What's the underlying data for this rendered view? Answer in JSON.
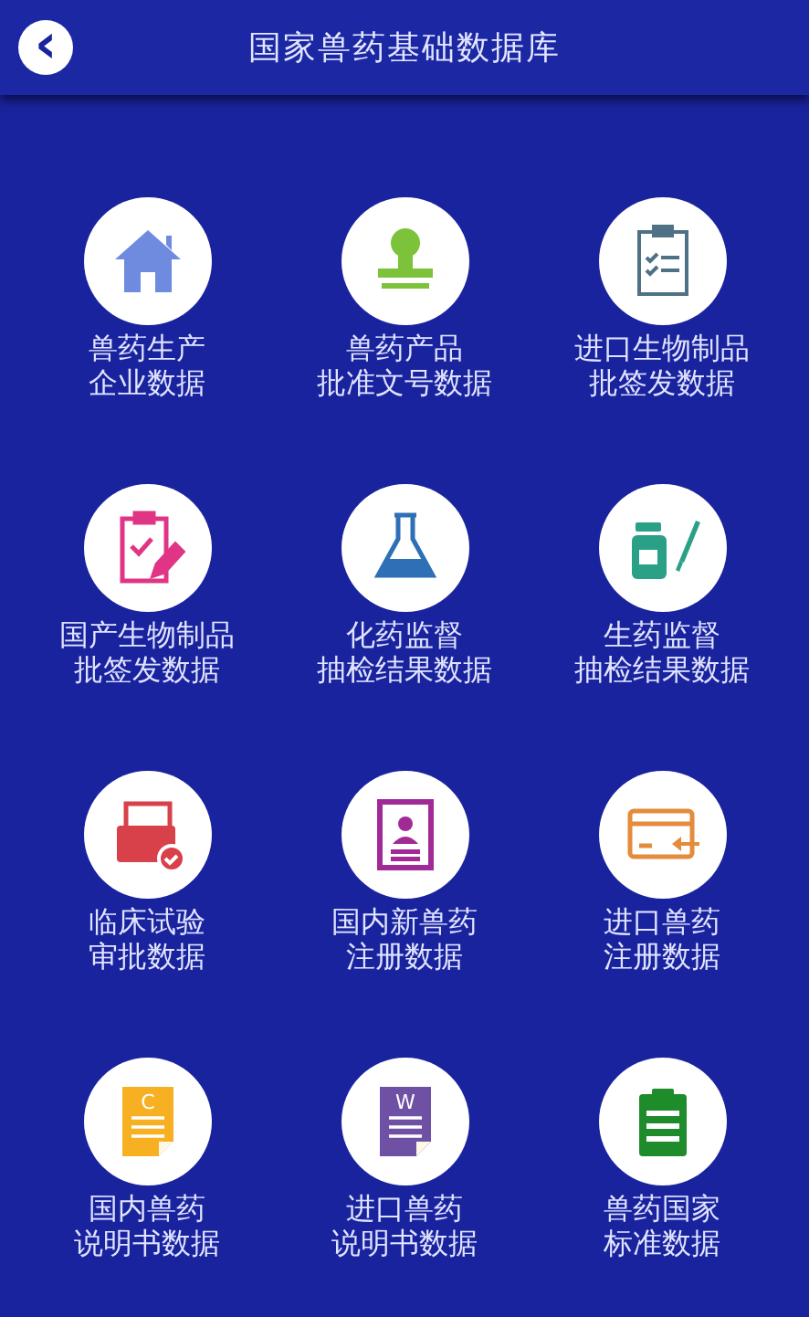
{
  "header": {
    "back_button": "‹",
    "title": "国家兽药基础数据库"
  },
  "items": [
    {
      "kind": "house",
      "lines": [
        "兽药生产",
        "企业数据"
      ]
    },
    {
      "kind": "stamp",
      "lines": [
        "兽药产品",
        "批准文号数据"
      ]
    },
    {
      "kind": "checklist",
      "lines": [
        "进口生物制品",
        "批签发数据"
      ]
    },
    {
      "kind": "clipboard-pencil",
      "lines": [
        "国产生物制品",
        "批签发数据"
      ]
    },
    {
      "kind": "flask",
      "lines": [
        "化药监督",
        "抽检结果数据"
      ]
    },
    {
      "kind": "bottle-syringe",
      "lines": [
        "生药监督",
        "抽检结果数据"
      ]
    },
    {
      "kind": "tray-check",
      "lines": [
        "临床试验",
        "审批数据"
      ]
    },
    {
      "kind": "id-card",
      "lines": [
        "国内新兽药",
        "注册数据"
      ]
    },
    {
      "kind": "card-arrow",
      "lines": [
        "进口兽药",
        "注册数据"
      ]
    },
    {
      "kind": "doc-orange",
      "letter": "C",
      "lines": [
        "国内兽药",
        "说明书数据"
      ]
    },
    {
      "kind": "doc-purple",
      "letter": "W",
      "lines": [
        "进口兽药",
        "说明书数据"
      ]
    },
    {
      "kind": "clipboard-green",
      "lines": [
        "兽药国家",
        "标准数据"
      ]
    }
  ]
}
